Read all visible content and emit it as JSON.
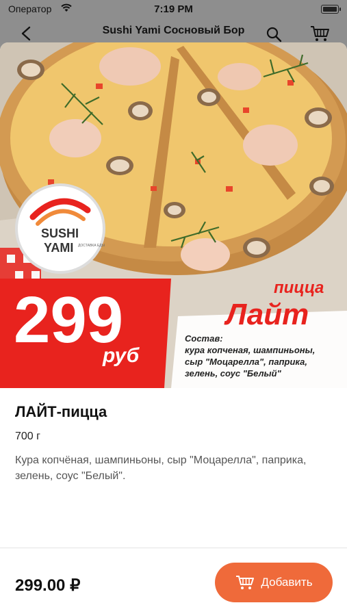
{
  "status_bar": {
    "carrier": "Оператор",
    "time": "7:19 PM"
  },
  "nav": {
    "title": "Sushi Yami Сосновый Бор"
  },
  "banner": {
    "brand_line1": "SUSHI",
    "brand_line2": "YAMI",
    "brand_tag": "ДОСТАВКА ЕДЫ",
    "price_big": "299",
    "price_unit": "руб",
    "pizza_word": "пицца",
    "pizza_name": "Лайт",
    "composition_title": "Состав:",
    "composition_lines": [
      "кура копченая, шампиньоны,",
      "сыр \"Моцарелла\", паприка,",
      "зелень, соус \"Белый\""
    ]
  },
  "product": {
    "name": "ЛАЙТ-пицца",
    "weight": "700 г",
    "description": "Кура копчёная, шампиньоны, сыр \"Моцарелла\", паприка, зелень, соус \"Белый\"."
  },
  "footer": {
    "price": "299.00 ₽",
    "add_label": "Добавить"
  },
  "colors": {
    "accent": "#ef6a3a",
    "banner_red": "#e8231e"
  }
}
